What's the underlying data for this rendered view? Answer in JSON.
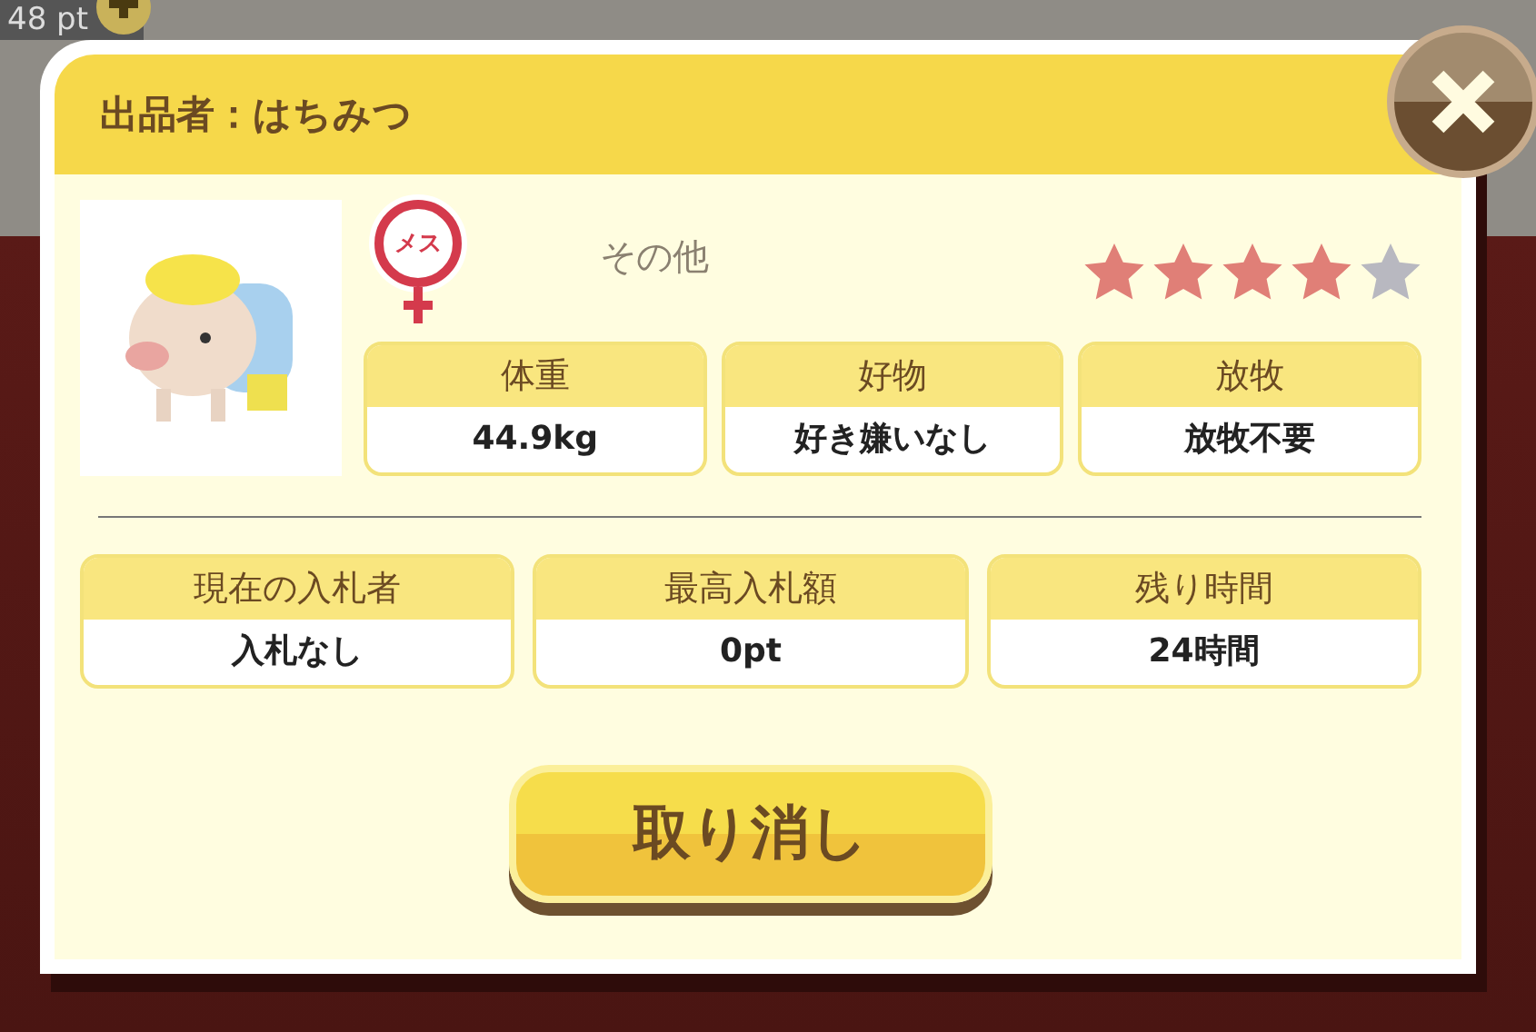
{
  "hud": {
    "points": "48 pt"
  },
  "dialog": {
    "title": "出品者：はちみつ",
    "gender": {
      "kind": "female",
      "label": "メス"
    },
    "category": "その他",
    "stars": 4,
    "stats": [
      {
        "label": "体重",
        "value": "44.9kg"
      },
      {
        "label": "好物",
        "value": "好き嫌いなし"
      },
      {
        "label": "放牧",
        "value": "放牧不要"
      }
    ],
    "bids": [
      {
        "label": "現在の入札者",
        "value": "入札なし"
      },
      {
        "label": "最高入札額",
        "value": "0pt"
      },
      {
        "label": "残り時間",
        "value": "24時間"
      }
    ],
    "cancel_button": "取り消し"
  }
}
